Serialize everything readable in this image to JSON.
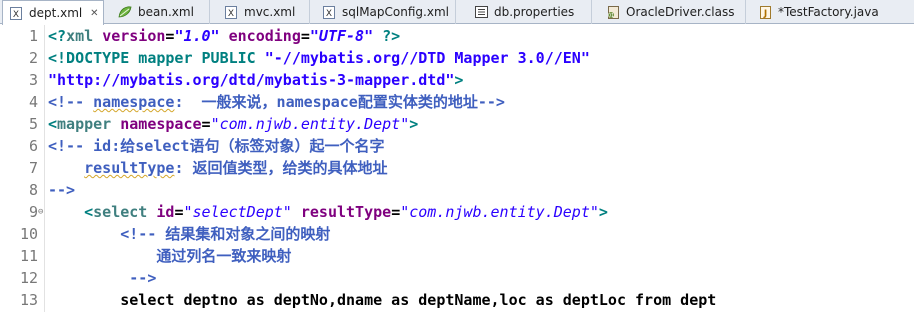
{
  "tabs": [
    {
      "label": "dept.xml",
      "icon": "xml-file-icon",
      "active": true,
      "close": "✕"
    },
    {
      "label": "bean.xml",
      "icon": "spring-leaf-icon",
      "active": false
    },
    {
      "label": "mvc.xml",
      "icon": "xml-file-icon",
      "active": false
    },
    {
      "label": "sqlMapConfig.xml",
      "icon": "xml-file-icon",
      "active": false
    },
    {
      "label": "db.properties",
      "icon": "properties-file-icon",
      "active": false
    },
    {
      "label": "OracleDriver.class",
      "icon": "class-file-icon",
      "active": false
    },
    {
      "label": "*TestFactory.java",
      "icon": "java-file-icon",
      "active": false
    }
  ],
  "code": {
    "lines": [
      {
        "n": "1",
        "segs": [
          "<?",
          "xml",
          " ",
          "version",
          "=",
          "\"1.0\"",
          " ",
          "encoding",
          "=",
          "\"UTF-8\"",
          " ",
          "?>"
        ]
      },
      {
        "n": "2",
        "segs": [
          "<!DOCTYPE mapper PUBLIC ",
          "\"-//mybatis.org//DTD Mapper 3.0//EN\""
        ]
      },
      {
        "n": "3",
        "segs": [
          "\"http://mybatis.org/dtd/mybatis-3-mapper.dtd\"",
          ">"
        ]
      },
      {
        "n": "4",
        "segs": [
          "<!-- ",
          "namespace",
          ":  ",
          "一般来说，",
          "namespace",
          "配置实体类的地址",
          "-->"
        ]
      },
      {
        "n": "5",
        "segs": [
          "<",
          "mapper",
          " ",
          "namespace",
          "=",
          "\"com.njwb.entity.Dept\"",
          ">"
        ]
      },
      {
        "n": "6",
        "segs": [
          "<!-- ",
          "id",
          ":",
          "给",
          "select",
          "语句（标签对象）起一个名字"
        ]
      },
      {
        "n": "7",
        "segs": [
          "    ",
          "resultType",
          ": ",
          "返回值类型，给类的具体地址"
        ]
      },
      {
        "n": "8",
        "segs": [
          "-->"
        ]
      },
      {
        "n": "9",
        "fold": "⊖",
        "segs": [
          "    ",
          "<",
          "select",
          " ",
          "id",
          "=",
          "\"selectDept\"",
          " ",
          "resultType",
          "=",
          "\"com.njwb.entity.Dept\"",
          ">"
        ]
      },
      {
        "n": "10",
        "segs": [
          "        ",
          "<!-- ",
          "结果集和对象之间的映射"
        ]
      },
      {
        "n": "11",
        "segs": [
          "            ",
          "通过列名一致来映射"
        ]
      },
      {
        "n": "12",
        "segs": [
          "         ",
          "-->"
        ]
      },
      {
        "n": "13",
        "segs": [
          "        ",
          "select deptno as deptNo,dname as deptName,loc as deptLoc from dept"
        ]
      }
    ]
  }
}
